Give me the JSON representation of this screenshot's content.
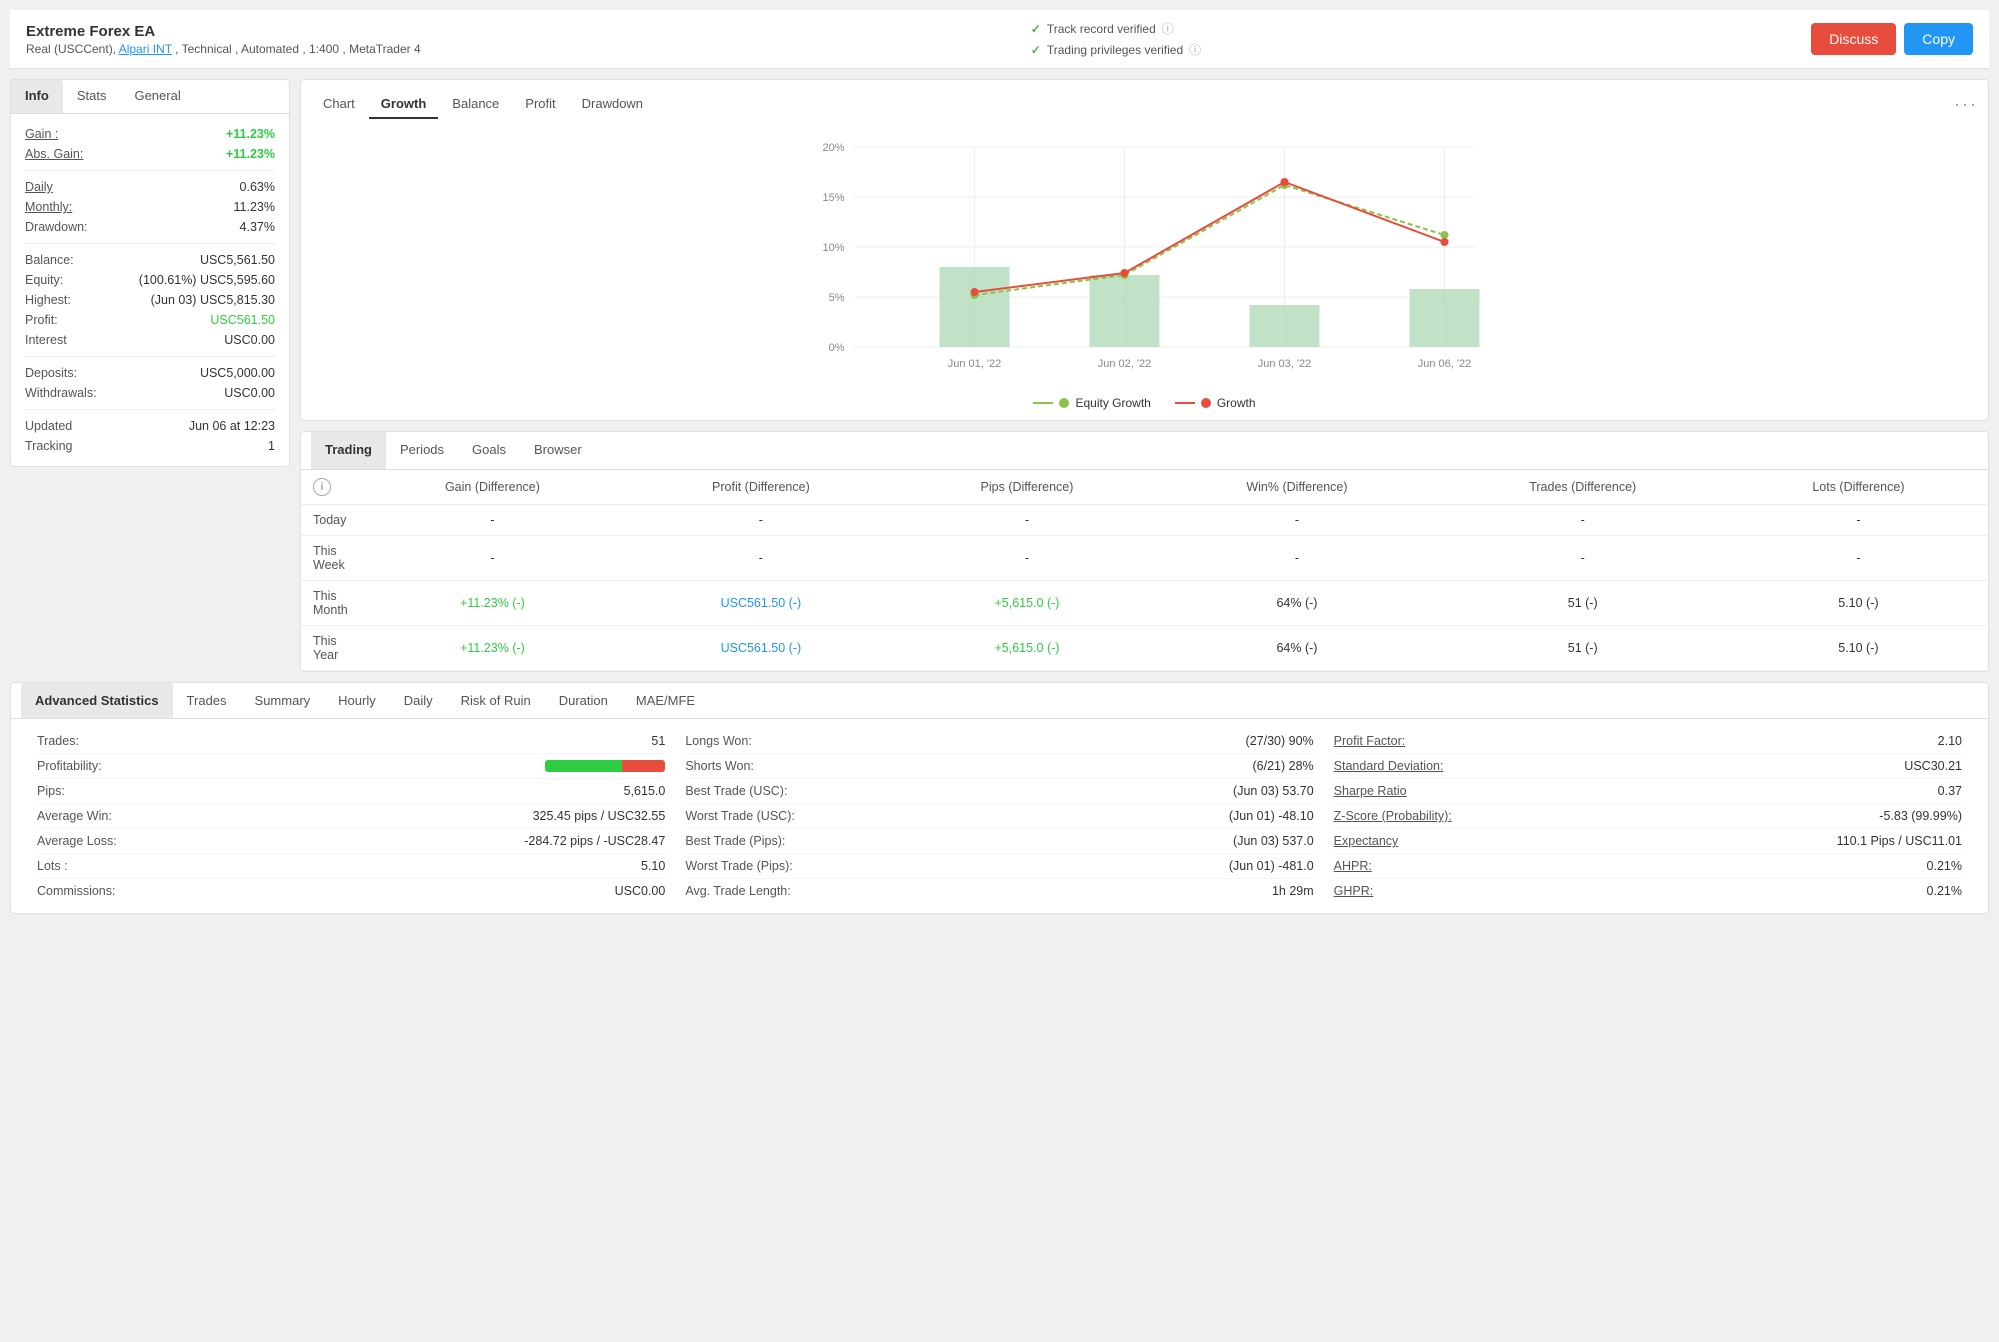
{
  "header": {
    "title": "Extreme Forex EA",
    "subtitle": "Real (USCCent), Alpari INT , Technical , Automated , 1:400 , MetaTrader 4",
    "verify1": "Track record verified",
    "verify2": "Trading privileges verified",
    "btn_discuss": "Discuss",
    "btn_copy": "Copy"
  },
  "info_tabs": [
    "Info",
    "Stats",
    "General"
  ],
  "stats": {
    "gain_label": "Gain :",
    "gain_value": "+11.23%",
    "abs_gain_label": "Abs. Gain:",
    "abs_gain_value": "+11.23%",
    "daily_label": "Daily",
    "daily_value": "0.63%",
    "monthly_label": "Monthly:",
    "monthly_value": "11.23%",
    "drawdown_label": "Drawdown:",
    "drawdown_value": "4.37%",
    "balance_label": "Balance:",
    "balance_value": "USC5,561.50",
    "equity_label": "Equity:",
    "equity_value": "(100.61%) USC5,595.60",
    "highest_label": "Highest:",
    "highest_value": "(Jun 03) USC5,815.30",
    "profit_label": "Profit:",
    "profit_value": "USC561.50",
    "interest_label": "Interest",
    "interest_value": "USC0.00",
    "deposits_label": "Deposits:",
    "deposits_value": "USC5,000.00",
    "withdrawals_label": "Withdrawals:",
    "withdrawals_value": "USC0.00",
    "updated_label": "Updated",
    "updated_value": "Jun 06 at 12:23",
    "tracking_label": "Tracking",
    "tracking_value": "1"
  },
  "chart_tabs": [
    "Chart",
    "Growth",
    "Balance",
    "Profit",
    "Drawdown"
  ],
  "chart": {
    "x_labels": [
      "Jun 01, '22",
      "Jun 02, '22",
      "Jun 03, '22",
      "Jun 06, '22"
    ],
    "y_labels": [
      "0%",
      "5%",
      "10%",
      "15%",
      "20%"
    ],
    "legend_equity": "Equity Growth",
    "legend_growth": "Growth"
  },
  "trading_tabs": [
    "Trading",
    "Periods",
    "Goals",
    "Browser"
  ],
  "trading_table": {
    "headers": [
      "",
      "Gain (Difference)",
      "Profit (Difference)",
      "Pips (Difference)",
      "Win% (Difference)",
      "Trades (Difference)",
      "Lots (Difference)"
    ],
    "rows": [
      {
        "period": "Today",
        "gain": "-",
        "profit": "-",
        "pips": "-",
        "win": "-",
        "trades": "-",
        "lots": "-"
      },
      {
        "period": "This Week",
        "gain": "-",
        "profit": "-",
        "pips": "-",
        "win": "-",
        "trades": "-",
        "lots": "-"
      },
      {
        "period": "This Month",
        "gain": "+11.23% (-)",
        "profit": "USC561.50 (-)",
        "pips": "+5,615.0 (-)",
        "win": "64% (-)",
        "trades": "51 (-)",
        "lots": "5.10 (-)"
      },
      {
        "period": "This Year",
        "gain": "+11.23% (-)",
        "profit": "USC561.50 (-)",
        "pips": "+5,615.0 (-)",
        "win": "64% (-)",
        "trades": "51 (-)",
        "lots": "5.10 (-)"
      }
    ]
  },
  "adv_tabs": [
    "Advanced Statistics",
    "Trades",
    "Summary",
    "Hourly",
    "Daily",
    "Risk of Ruin",
    "Duration",
    "MAE/MFE"
  ],
  "adv_stats": {
    "col1": [
      {
        "label": "Trades:",
        "value": "51"
      },
      {
        "label": "Profitability:",
        "value": "bar"
      },
      {
        "label": "Pips:",
        "value": "5,615.0"
      },
      {
        "label": "Average Win:",
        "value": "325.45 pips / USC32.55"
      },
      {
        "label": "Average Loss:",
        "value": "-284.72 pips / -USC28.47"
      },
      {
        "label": "Lots :",
        "value": "5.10"
      },
      {
        "label": "Commissions:",
        "value": "USC0.00"
      }
    ],
    "col2": [
      {
        "label": "Longs Won:",
        "value": "(27/30) 90%"
      },
      {
        "label": "Shorts Won:",
        "value": "(6/21) 28%"
      },
      {
        "label": "Best Trade (USC):",
        "value": "(Jun 03) 53.70"
      },
      {
        "label": "Worst Trade (USC):",
        "value": "(Jun 01) -48.10"
      },
      {
        "label": "Best Trade (Pips):",
        "value": "(Jun 03) 537.0"
      },
      {
        "label": "Worst Trade (Pips):",
        "value": "(Jun 01) -481.0"
      },
      {
        "label": "Avg. Trade Length:",
        "value": "1h 29m"
      }
    ],
    "col3": [
      {
        "label": "Profit Factor:",
        "value": "2.10",
        "underline": true
      },
      {
        "label": "Standard Deviation:",
        "value": "USC30.21",
        "underline": true
      },
      {
        "label": "Sharpe Ratio",
        "value": "0.37",
        "underline": true
      },
      {
        "label": "Z-Score (Probability):",
        "value": "-5.83 (99.99%)",
        "underline": true
      },
      {
        "label": "Expectancy",
        "value": "110.1 Pips / USC11.01",
        "underline": true
      },
      {
        "label": "AHPR:",
        "value": "0.21%",
        "underline": true
      },
      {
        "label": "GHPR:",
        "value": "0.21%",
        "underline": true
      }
    ]
  }
}
